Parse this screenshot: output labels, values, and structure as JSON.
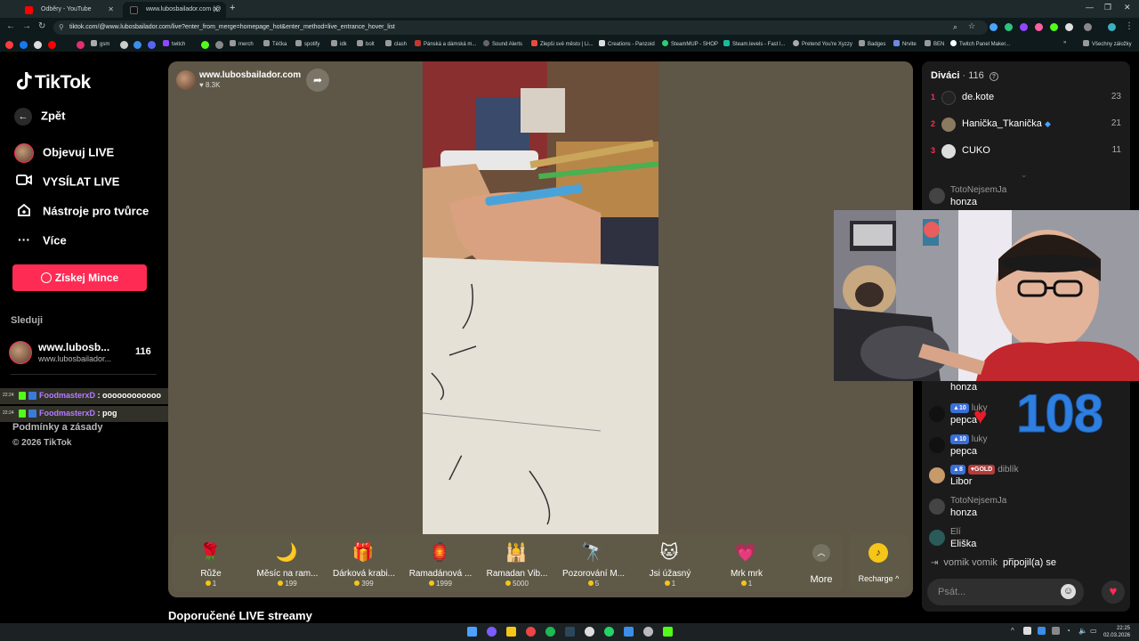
{
  "browser": {
    "tabs": [
      {
        "title": "Odběry - YouTube",
        "color": "#ff0000"
      },
      {
        "title": "www.lubosbailador.com (@",
        "color": "#111111"
      }
    ],
    "url": "tiktok.com/@www.lubosbailador.com/live?enter_from_merge=homepage_hot&enter_method=live_entrance_hover_list",
    "bookmarks": [
      "gsm",
      "twitch",
      "merch",
      "Téčka",
      "spotify",
      "idk",
      "bolt",
      "clash",
      "Pánská a dámská m...",
      "Sound Alerts",
      "Zlepši své město | Li...",
      "Creations - Panzoid",
      "SteamMUP - SHOP",
      "Steam.levels - Fast l...",
      "Pretend You're Xyzzy",
      "Badges",
      "Nrvite",
      "BEN",
      "Twitch Panel Maker..."
    ],
    "all_bookmarks": "Všechny záložky"
  },
  "sidebar": {
    "logo": "TikTok",
    "back": "Zpět",
    "nav": [
      "Objevuj LIVE",
      "VYSÍLAT LIVE",
      "Nástroje pro tvůrce",
      "Více"
    ],
    "coins_button": "Získej Mince",
    "following_title": "Sleduji",
    "following": {
      "name": "www.lubosb...",
      "handle": "www.lubosbailador...",
      "count": "116"
    },
    "footer1": "Podmínky a zásady",
    "footer2": "© 2026 TikTok"
  },
  "overlay_chat": [
    {
      "time": "22:24",
      "user": "FoodmasterxD",
      "msg": ": oooooooooooo"
    },
    {
      "time": "22:24",
      "user": "FoodmasterxD",
      "msg": ": pog"
    }
  ],
  "stage": {
    "host_name": "www.lubosbailador.com",
    "host_likes": "8.3K",
    "gifts": [
      {
        "name": "Růže",
        "price": "1",
        "icon": "🌹"
      },
      {
        "name": "Měsíc na ram...",
        "price": "199",
        "icon": "🌙"
      },
      {
        "name": "Dárková krabi...",
        "price": "399",
        "icon": "🎁"
      },
      {
        "name": "Ramadánová ...",
        "price": "1999",
        "icon": "🏮"
      },
      {
        "name": "Ramadan Vib...",
        "price": "5000",
        "icon": "🕌"
      },
      {
        "name": "Pozorování M...",
        "price": "5",
        "icon": "🔭"
      },
      {
        "name": "Jsi úžasný",
        "price": "1",
        "icon": "🐱"
      },
      {
        "name": "Mrk mrk",
        "price": "1",
        "icon": "💗"
      }
    ],
    "more": "More",
    "recharge": "Recharge",
    "recommended": "Doporučené LIVE streamy"
  },
  "viewers": {
    "title": "Diváci",
    "count": "116",
    "list": [
      {
        "rank": "1",
        "name": "de.kote",
        "score": "23",
        "color": "#222222"
      },
      {
        "rank": "2",
        "name": "Hanička_Tkanička",
        "score": "21",
        "color": "#8a7a60"
      },
      {
        "rank": "3",
        "name": "CUKO",
        "score": "11",
        "color": "#dddddd"
      }
    ]
  },
  "chat": [
    {
      "user": "TotoNejsemJa",
      "text": "honza",
      "avatar": "#3a3a3a"
    },
    {
      "user": "",
      "text": "honza",
      "avatar": "#3a3a3a"
    },
    {
      "user": "luky",
      "text": "pepca",
      "badge": "10",
      "avatar": "#111111"
    },
    {
      "user": "luky",
      "text": "pepca",
      "badge": "10",
      "avatar": "#111111"
    },
    {
      "user": "diblík",
      "text": "Libor",
      "badge": "8",
      "gold": "GOLD",
      "avatar": "#c79a6a"
    },
    {
      "user": "TotoNejsemJa",
      "text": "honza",
      "avatar": "#3a3a3a"
    },
    {
      "user": "Elí",
      "text": "Eliška",
      "avatar": "#2a5a5a"
    }
  ],
  "join_notice": {
    "user": "vomik vomik",
    "text": "připojil(a) se"
  },
  "chat_input_placeholder": "Psát...",
  "webcam_counter": "108",
  "taskbar": {
    "time": "22:25",
    "date": "02.03.2026"
  }
}
